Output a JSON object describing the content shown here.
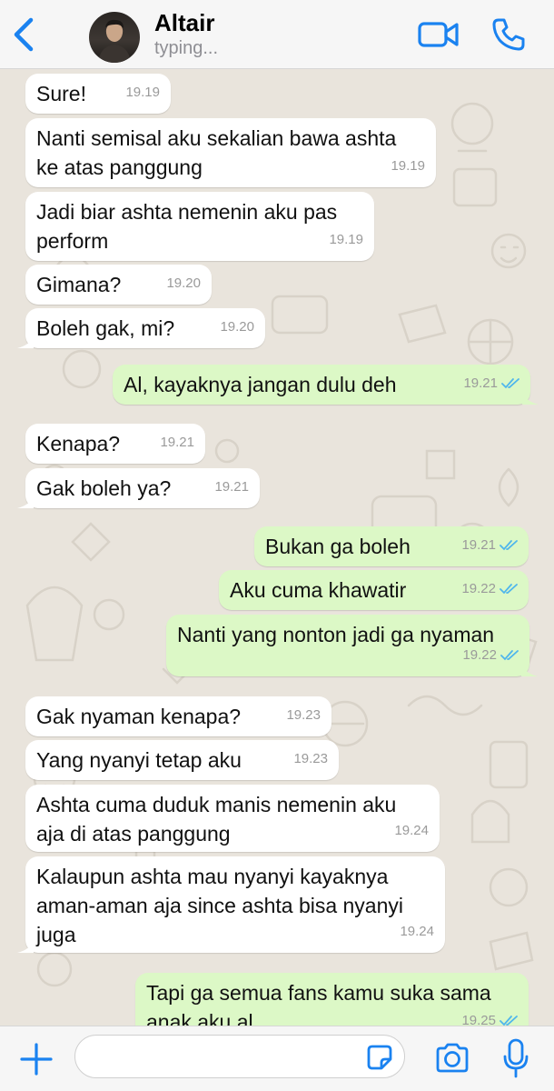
{
  "header": {
    "contact_name": "Altair",
    "status": "typing..."
  },
  "colors": {
    "accent": "#1a82f0",
    "incoming_bubble": "#ffffff",
    "outgoing_bubble": "#dcf8c6",
    "read_ticks": "#4fb6ec"
  },
  "messages": [
    {
      "dir": "in",
      "text": "Sure!",
      "time": "19.19"
    },
    {
      "dir": "in",
      "text": "Nanti semisal aku sekalian bawa ashta\nke atas panggung",
      "time": "19.19"
    },
    {
      "dir": "in",
      "text": "Jadi biar ashta nemenin aku pas\nperform",
      "time": "19.19"
    },
    {
      "dir": "in",
      "text": "Gimana?",
      "time": "19.20"
    },
    {
      "dir": "in",
      "text": "Boleh gak, mi?",
      "time": "19.20"
    },
    {
      "dir": "out",
      "text": "Al, kayaknya jangan dulu deh",
      "time": "19.21",
      "read": true
    },
    {
      "dir": "in",
      "text": "Kenapa?",
      "time": "19.21"
    },
    {
      "dir": "in",
      "text": "Gak boleh ya?",
      "time": "19.21"
    },
    {
      "dir": "out",
      "text": "Bukan ga boleh",
      "time": "19.21",
      "read": true
    },
    {
      "dir": "out",
      "text": "Aku cuma khawatir",
      "time": "19.22",
      "read": true
    },
    {
      "dir": "out",
      "text": "Nanti yang nonton jadi ga nyaman",
      "time": "19.22",
      "read": true
    },
    {
      "dir": "in",
      "text": "Gak nyaman kenapa?",
      "time": "19.23"
    },
    {
      "dir": "in",
      "text": "Yang nyanyi tetap aku",
      "time": "19.23"
    },
    {
      "dir": "in",
      "text": "Ashta cuma duduk manis nemenin aku\naja di atas panggung",
      "time": "19.24"
    },
    {
      "dir": "in",
      "text": "Kalaupun ashta mau nyanyi kayaknya\naman-aman aja since ashta bisa nyanyi\njuga",
      "time": "19.24"
    },
    {
      "dir": "out",
      "text": "Tapi ga semua fans kamu suka sama\nanak aku al",
      "time": "19.25",
      "read": true
    }
  ],
  "composer": {
    "value": "",
    "placeholder": ""
  },
  "icons": [
    "back-chevron-icon",
    "video-call-icon",
    "phone-icon",
    "plus-icon",
    "sticker-icon",
    "camera-icon",
    "microphone-icon"
  ]
}
